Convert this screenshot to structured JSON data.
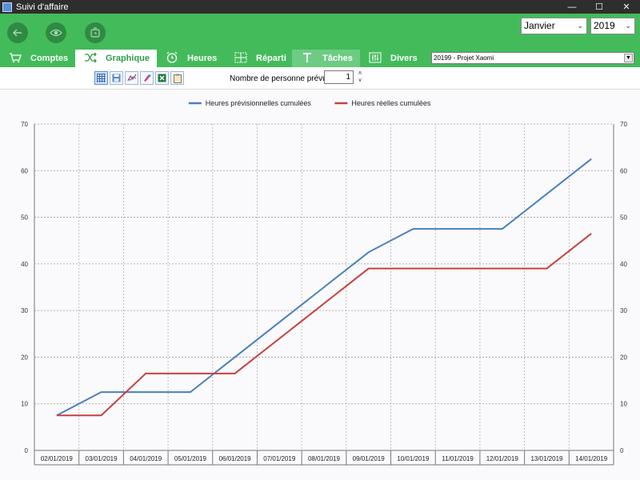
{
  "window": {
    "title": "Suivi d'affaire",
    "controls": {
      "minimize": "—",
      "maximize": "☐",
      "close": "✕"
    }
  },
  "header": {
    "buttons": [
      {
        "name": "back",
        "icon": "arrow-left-icon"
      },
      {
        "name": "view",
        "icon": "eye-icon"
      },
      {
        "name": "refresh",
        "icon": "refresh-icon"
      }
    ],
    "month": "Janvier",
    "year": "2019"
  },
  "tabs": [
    {
      "label": "Comptes",
      "icon": "cart-icon",
      "state": "normal"
    },
    {
      "label": "Graphique",
      "icon": "shuffle-icon",
      "state": "active"
    },
    {
      "label": "Heures",
      "icon": "alarm-clock-icon",
      "state": "normal"
    },
    {
      "label": "Réparti",
      "icon": "grid-icon",
      "state": "normal"
    },
    {
      "label": "Tâches",
      "icon": "hammer-icon",
      "state": "hover"
    },
    {
      "label": "Divers",
      "icon": "sliders-icon",
      "state": "normal"
    }
  ],
  "project": "20199 - Projet Xaomi",
  "toolbar": {
    "tools": [
      "grid-view-icon",
      "save-icon",
      "chart-icon",
      "paint-icon",
      "excel-export-icon",
      "clipboard-icon"
    ]
  },
  "people": {
    "label": "Nombre de personne prévu :",
    "value": "1"
  },
  "colors": {
    "header_green": "#43bb5b",
    "series_previsional": "#4a7fbf",
    "series_real": "#c8403e"
  },
  "chart_data": {
    "type": "line",
    "categories": [
      "02/01/2019",
      "03/01/2019",
      "04/01/2019",
      "05/01/2019",
      "06/01/2019",
      "07/01/2019",
      "08/01/2019",
      "09/01/2019",
      "10/01/2019",
      "11/01/2019",
      "12/01/2019",
      "13/01/2019",
      "14/01/2019"
    ],
    "series": [
      {
        "name": "Heures prévisionnelles cumulées",
        "values": [
          7.5,
          12.5,
          12.5,
          12.5,
          20,
          27.5,
          35,
          42.5,
          47.5,
          47.5,
          47.5,
          55,
          62.5
        ]
      },
      {
        "name": "Heures réelles cumulées",
        "values": [
          7.5,
          7.5,
          16.5,
          16.5,
          16.5,
          24,
          31.5,
          39,
          39,
          39,
          39,
          39,
          46.5
        ]
      }
    ],
    "ylim": [
      0,
      70
    ],
    "yticks": [
      0,
      10,
      20,
      30,
      40,
      50,
      60,
      70
    ],
    "grid": true,
    "legend_position": "top-center",
    "secondary_y_axis": true
  }
}
